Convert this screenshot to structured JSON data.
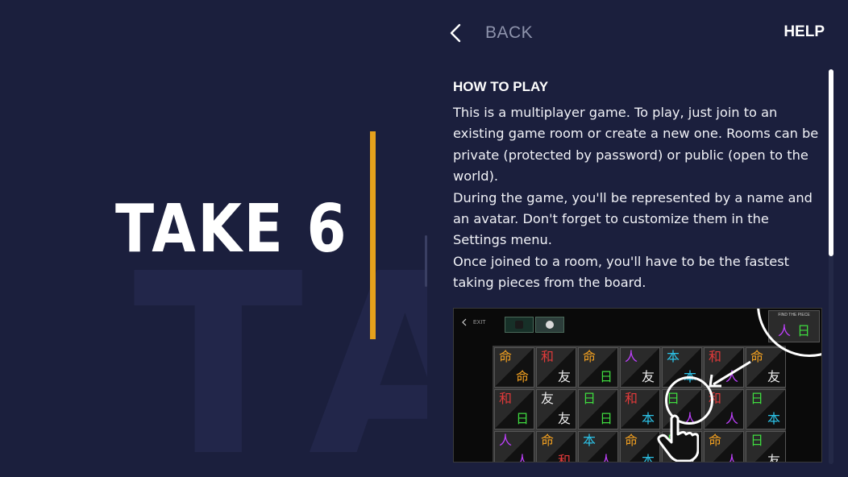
{
  "left": {
    "title": "TAKE 6",
    "watermark": "TA",
    "accent_color": "#e5a11c"
  },
  "topbar": {
    "back_label": "BACK",
    "help_label": "HELP"
  },
  "help": {
    "section_title": "HOW TO PLAY",
    "paragraphs": [
      "This is a multiplayer game. To play, just join to an existing game room or create a new one. Rooms can be private (protected by password) or public (open to the world).",
      "During the game, you'll be represented by a name and an avatar. Don't forget to customize them in the Settings menu.",
      "Once joined to a room, you'll have to be the fastest taking pieces from the board."
    ]
  },
  "screenshot": {
    "exit_label": "EXIT",
    "find_label": "FIND THE PIECE",
    "find_chars": [
      {
        "char": "人",
        "color": "purple"
      },
      {
        "char": "日",
        "color": "green"
      }
    ],
    "board": [
      [
        [
          "命",
          "orange",
          "命",
          "orange"
        ],
        [
          "和",
          "red",
          "友",
          "white"
        ],
        [
          "命",
          "orange",
          "日",
          "green"
        ],
        [
          "人",
          "purple",
          "友",
          "white"
        ],
        [
          "本",
          "cyan",
          "本",
          "cyan"
        ],
        [
          "和",
          "red",
          "人",
          "purple"
        ],
        [
          "命",
          "orange",
          "友",
          "white"
        ]
      ],
      [
        [
          "和",
          "red",
          "日",
          "green"
        ],
        [
          "友",
          "white",
          "友",
          "white"
        ],
        [
          "日",
          "green",
          "日",
          "green"
        ],
        [
          "和",
          "red",
          "本",
          "cyan"
        ],
        [
          "日",
          "green",
          "人",
          "purple"
        ],
        [
          "和",
          "red",
          "人",
          "purple"
        ],
        [
          "日",
          "green",
          "本",
          "cyan"
        ]
      ],
      [
        [
          "人",
          "purple",
          "人",
          "purple"
        ],
        [
          "命",
          "orange",
          "和",
          "red"
        ],
        [
          "本",
          "cyan",
          "人",
          "purple"
        ],
        [
          "命",
          "orange",
          "本",
          "cyan"
        ],
        [
          "日",
          "green",
          "友",
          "white"
        ],
        [
          "命",
          "orange",
          "人",
          "purple"
        ],
        [
          "日",
          "green",
          "友",
          "white"
        ]
      ]
    ]
  }
}
